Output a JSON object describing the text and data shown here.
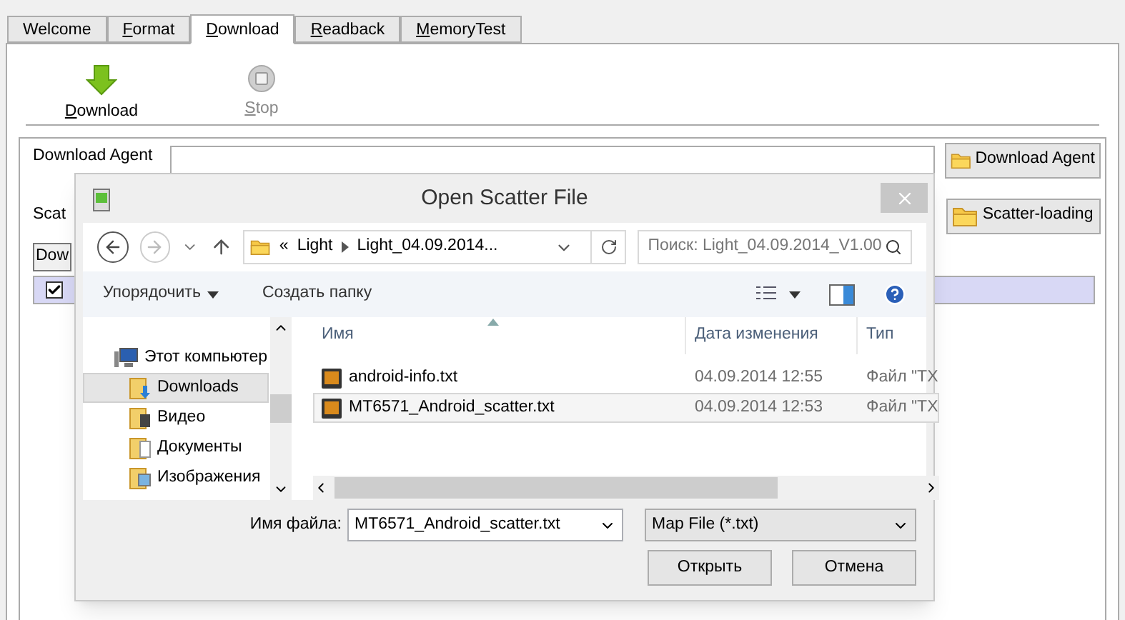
{
  "tabs": [
    {
      "label": "Welcome",
      "selected": false,
      "underline_first": false
    },
    {
      "label": "Format",
      "selected": false,
      "underline_first": true
    },
    {
      "label": "Download",
      "selected": true,
      "underline_first": true
    },
    {
      "label": "Readback",
      "selected": false,
      "underline_first": true
    },
    {
      "label": "MemoryTest",
      "selected": false,
      "underline_first": true
    }
  ],
  "toolbar": [
    {
      "label": "Download",
      "kind": "download",
      "disabled": false,
      "underline_first": true
    },
    {
      "label": "Stop",
      "kind": "stop",
      "disabled": true,
      "underline_first": true
    }
  ],
  "download_agent": {
    "label": "Download Agent",
    "button": "Download Agent"
  },
  "scatter": {
    "label": "Scat",
    "button": "Scatter-loading"
  },
  "partial_button": "Dow",
  "header_checkbox": {
    "checked": true
  },
  "dialog": {
    "title": "Open Scatter File",
    "breadcrumb_prefix": "«",
    "breadcrumb": [
      "Light",
      "Light_04.09.2014..."
    ],
    "search_placeholder": "Поиск: Light_04.09.2014_V1.00",
    "organize": "Упорядочить",
    "new_folder": "Создать папку",
    "nav": [
      {
        "label": "Этот компьютер",
        "kind": "computer",
        "selected": false,
        "children": [
          {
            "label": "Downloads",
            "kind": "downloads",
            "selected": true
          },
          {
            "label": "Видео",
            "kind": "video",
            "selected": false
          },
          {
            "label": "Документы",
            "kind": "documents",
            "selected": false
          },
          {
            "label": "Изображения",
            "kind": "pictures",
            "selected": false
          }
        ]
      }
    ],
    "columns": [
      "Имя",
      "Дата изменения",
      "Тип"
    ],
    "rows": [
      {
        "name": "android-info.txt",
        "date": "04.09.2014 12:55",
        "type": "Файл \"TX",
        "selected": false
      },
      {
        "name": "MT6571_Android_scatter.txt",
        "date": "04.09.2014 12:53",
        "type": "Файл \"TX",
        "selected": true
      }
    ],
    "filename_label": "Имя файла:",
    "filename": "MT6571_Android_scatter.txt",
    "filter": "Map File (*.txt)",
    "buttons": [
      "Открыть",
      "Отмена"
    ]
  }
}
